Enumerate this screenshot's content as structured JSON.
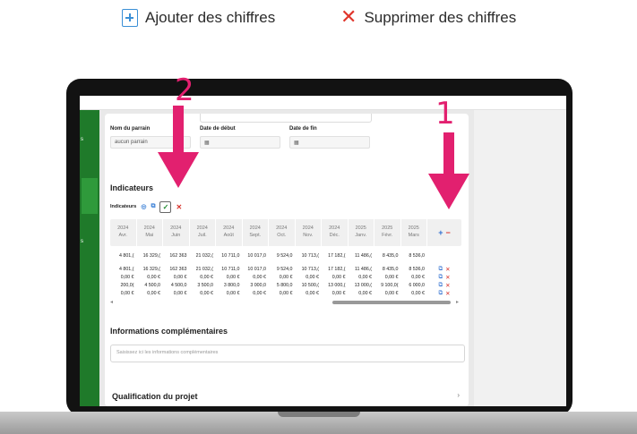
{
  "legend": {
    "add_label": "Ajouter des chiffres",
    "delete_label": "Supprimer des chiffres"
  },
  "annotations": {
    "step1": "1",
    "step2": "2"
  },
  "form": {
    "sponsor_label": "Nom du parrain",
    "sponsor_value": "aucun parrain",
    "start_label": "Date de début",
    "end_label": "Date de fin"
  },
  "indicators": {
    "section_title": "Indicateurs",
    "bar_label": "Indicateurs",
    "months": [
      {
        "year": "2024",
        "month": "Avr."
      },
      {
        "year": "2024",
        "month": "Mai"
      },
      {
        "year": "2024",
        "month": "Juin"
      },
      {
        "year": "2024",
        "month": "Juil."
      },
      {
        "year": "2024",
        "month": "Août"
      },
      {
        "year": "2024",
        "month": "Sept."
      },
      {
        "year": "2024",
        "month": "Oct."
      },
      {
        "year": "2024",
        "month": "Nov."
      },
      {
        "year": "2024",
        "month": "Déc."
      },
      {
        "year": "2025",
        "month": "Janv."
      },
      {
        "year": "2025",
        "month": "Févr."
      },
      {
        "year": "2025",
        "month": "Mars"
      }
    ],
    "total_row": [
      "4 801,(",
      "16 329,(",
      "162 363",
      "21 032,(",
      "10 711,0",
      "10 017,0",
      "9 524,0",
      "10 713,(",
      "17 182,(",
      "11 486,(",
      "8 435,0",
      "8 536,0"
    ],
    "rows": [
      [
        "4 801,(",
        "16 329,(",
        "162 363",
        "21 032,(",
        "10 711,0",
        "10 017,0",
        "9 524,0",
        "10 713,(",
        "17 182,(",
        "11 486,(",
        "8 435,0",
        "8 536,0"
      ],
      [
        "0,00 €",
        "0,00 €",
        "0,00 €",
        "0,00 €",
        "0,00 €",
        "0,00 €",
        "0,00 €",
        "0,00 €",
        "0,00 €",
        "0,00 €",
        "0,00 €",
        "0,00 €"
      ],
      [
        "200,0(",
        "4 500,0",
        "4 500,0",
        "3 500,0",
        "3 800,0",
        "3 000,0",
        "5 800,0",
        "10 500,(",
        "13 000,(",
        "13 000,(",
        "9 100,0(",
        "6 000,0"
      ],
      [
        "0,00 €",
        "0,00 €",
        "0,00 €",
        "0,00 €",
        "0,00 €",
        "0,00 €",
        "0,00 €",
        "0,00 €",
        "0,00 €",
        "0,00 €",
        "0,00 €",
        "0,00 €"
      ]
    ]
  },
  "info": {
    "title": "Informations complémentaires",
    "placeholder": "Saisissez ici les informations complémentaires"
  },
  "qualification": {
    "title": "Qualification du projet"
  },
  "colors": {
    "annotation": "#e2206f",
    "sidebar": "#1f7a2a",
    "delete": "#d8322b",
    "add": "#2f6fd0"
  }
}
